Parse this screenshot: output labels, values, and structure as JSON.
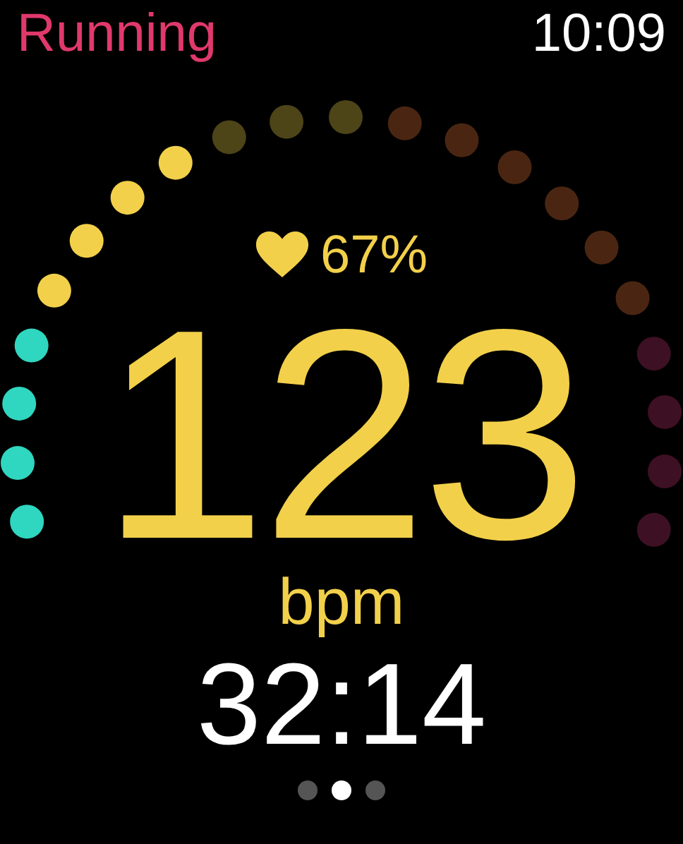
{
  "workout": {
    "title": "Running"
  },
  "clock": {
    "time": "10:09"
  },
  "heart_rate": {
    "zone_percent": "67%",
    "value": "123",
    "unit": "bpm"
  },
  "zone_dots": [
    {
      "color": "#2fd6c0"
    },
    {
      "color": "#2fd6c0"
    },
    {
      "color": "#2fd6c0"
    },
    {
      "color": "#2fd6c0"
    },
    {
      "color": "#f2d04a"
    },
    {
      "color": "#f2d04a"
    },
    {
      "color": "#f2d04a"
    },
    {
      "color": "#f2d04a"
    },
    {
      "color": "#4d4418"
    },
    {
      "color": "#4d4418"
    },
    {
      "color": "#4d4418"
    },
    {
      "color": "#4a2612"
    },
    {
      "color": "#4a2612"
    },
    {
      "color": "#4a2612"
    },
    {
      "color": "#4a2612"
    },
    {
      "color": "#4a2612"
    },
    {
      "color": "#4a2612"
    },
    {
      "color": "#3e1024"
    },
    {
      "color": "#3e1024"
    },
    {
      "color": "#3e1024"
    },
    {
      "color": "#3e1024"
    }
  ],
  "elapsed": {
    "time": "32:14"
  },
  "pages": [
    {
      "selected": false
    },
    {
      "selected": true
    },
    {
      "selected": false
    }
  ]
}
